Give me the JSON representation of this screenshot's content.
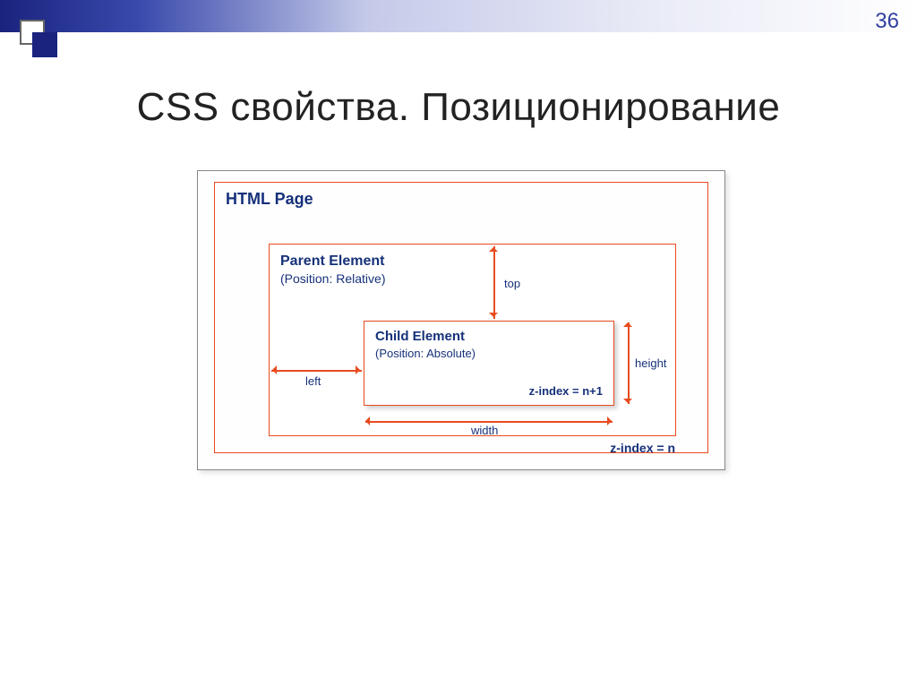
{
  "slide": {
    "number": "36",
    "title": "CSS свойства. Позиционирование"
  },
  "diagram": {
    "page_label": "HTML Page",
    "parent": {
      "title": "Parent Element",
      "subtitle": "(Position: Relative)",
      "zindex": "z-index = n"
    },
    "child": {
      "title": "Child Element",
      "subtitle": "(Position: Absolute)",
      "zindex": "z-index = n+1"
    },
    "arrows": {
      "top": "top",
      "left": "left",
      "width": "width",
      "height": "height"
    }
  }
}
